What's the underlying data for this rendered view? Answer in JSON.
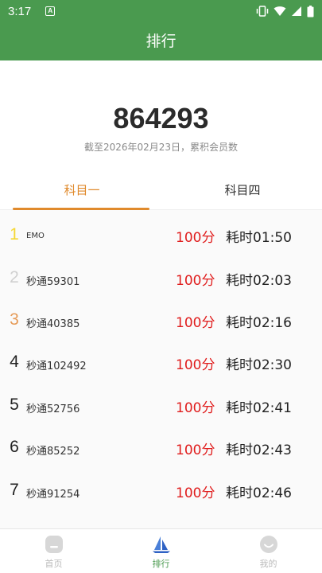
{
  "status_bar": {
    "time": "3:17",
    "app_icon_letter": "A"
  },
  "app_bar": {
    "title": "排行"
  },
  "summary": {
    "total": "864293",
    "caption": "截至2026年02月23日，累积会员数"
  },
  "tabs": [
    {
      "label": "科目一",
      "active": true
    },
    {
      "label": "科目四",
      "active": false
    }
  ],
  "rankings": [
    {
      "rank": "1",
      "name": "EMO",
      "score": "100分",
      "time": "耗时01:50",
      "rank_color": "#f5d733"
    },
    {
      "rank": "2",
      "name": "秒通59301",
      "score": "100分",
      "time": "耗时02:03",
      "rank_color": "#d0d0d0"
    },
    {
      "rank": "3",
      "name": "秒通40385",
      "score": "100分",
      "time": "耗时02:16",
      "rank_color": "#e69b58"
    },
    {
      "rank": "4",
      "name": "秒通102492",
      "score": "100分",
      "time": "耗时02:30",
      "rank_color": "#222222"
    },
    {
      "rank": "5",
      "name": "秒通52756",
      "score": "100分",
      "time": "耗时02:41",
      "rank_color": "#222222"
    },
    {
      "rank": "6",
      "name": "秒通85252",
      "score": "100分",
      "time": "耗时02:43",
      "rank_color": "#222222"
    },
    {
      "rank": "7",
      "name": "秒通91254",
      "score": "100分",
      "time": "耗时02:46",
      "rank_color": "#222222"
    }
  ],
  "bottom_nav": [
    {
      "label": "首页",
      "icon": "home-icon"
    },
    {
      "label": "排行",
      "icon": "sailboat-icon",
      "active": true
    },
    {
      "label": "我的",
      "icon": "smiley-icon"
    }
  ],
  "colors": {
    "primary": "#4a9a4f",
    "accent": "#e08a2c",
    "score": "#e01e1e"
  }
}
